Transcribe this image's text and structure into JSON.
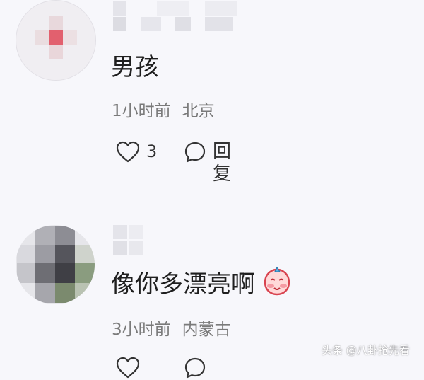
{
  "comments": [
    {
      "text": "男孩",
      "time": "1小时前",
      "location": "北京",
      "likes": "3",
      "reply_label": "回复"
    },
    {
      "text": "像你多漂亮啊",
      "time": "3小时前",
      "location": "内蒙古",
      "emoji": "blushing-face-emoji"
    }
  ],
  "watermark": "头条 @八卦抢先看",
  "colors": {
    "background": "#f7f7fb",
    "text": "#1f1f1f",
    "meta": "#7a7a7a"
  }
}
